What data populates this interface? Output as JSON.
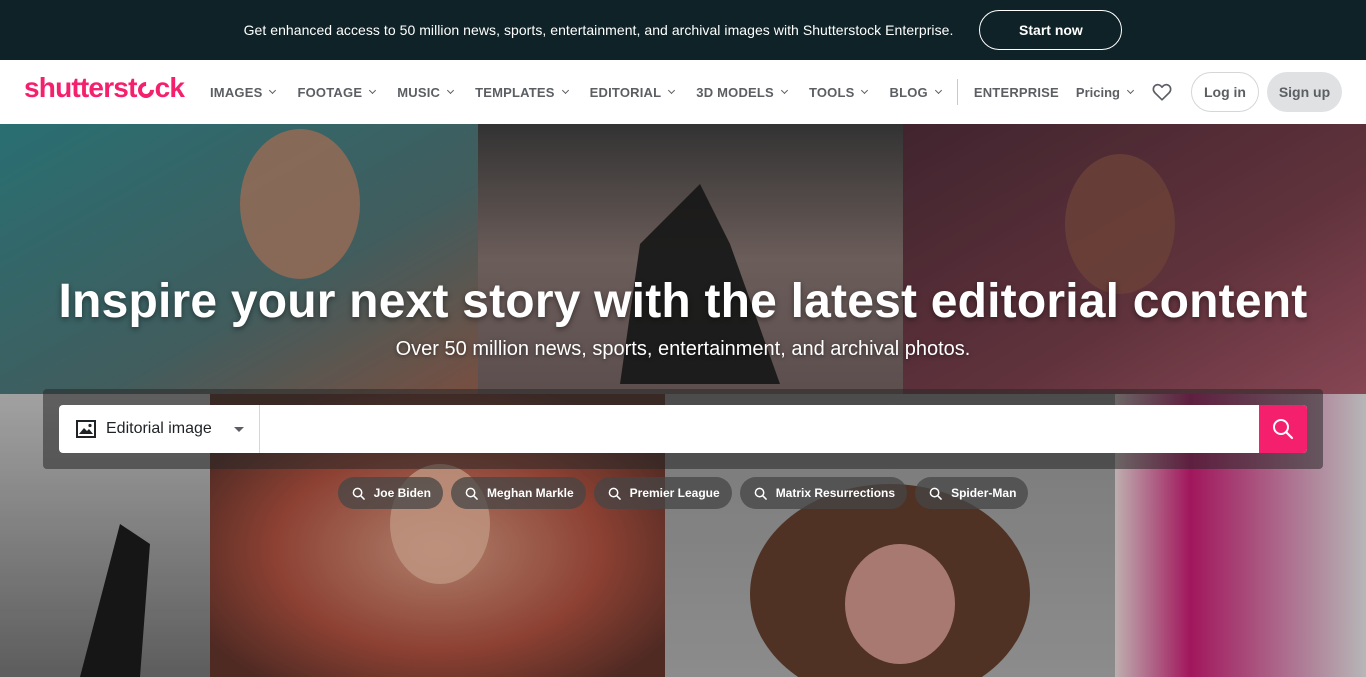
{
  "promo": {
    "text": "Get enhanced access to 50 million news, sports, entertainment, and archival images with Shutterstock Enterprise.",
    "cta": "Start now"
  },
  "nav": {
    "logo": "shutterstock",
    "menu": [
      "IMAGES",
      "FOOTAGE",
      "MUSIC",
      "TEMPLATES",
      "EDITORIAL",
      "3D MODELS",
      "TOOLS",
      "BLOG"
    ],
    "enterprise": "ENTERPRISE",
    "pricing": "Pricing",
    "login": "Log in",
    "signup": "Sign up"
  },
  "hero": {
    "title": "Inspire your next story with the latest editorial content",
    "subtitle": "Over 50 million news, sports, entertainment, and archival photos.",
    "search_type": "Editorial image",
    "search_value": "",
    "chips": [
      "Joe Biden",
      "Meghan Markle",
      "Premier League",
      "Matrix Resurrections",
      "Spider-Man"
    ]
  },
  "colors": {
    "brand": "#f5206d",
    "banner_bg": "#0f2227"
  }
}
